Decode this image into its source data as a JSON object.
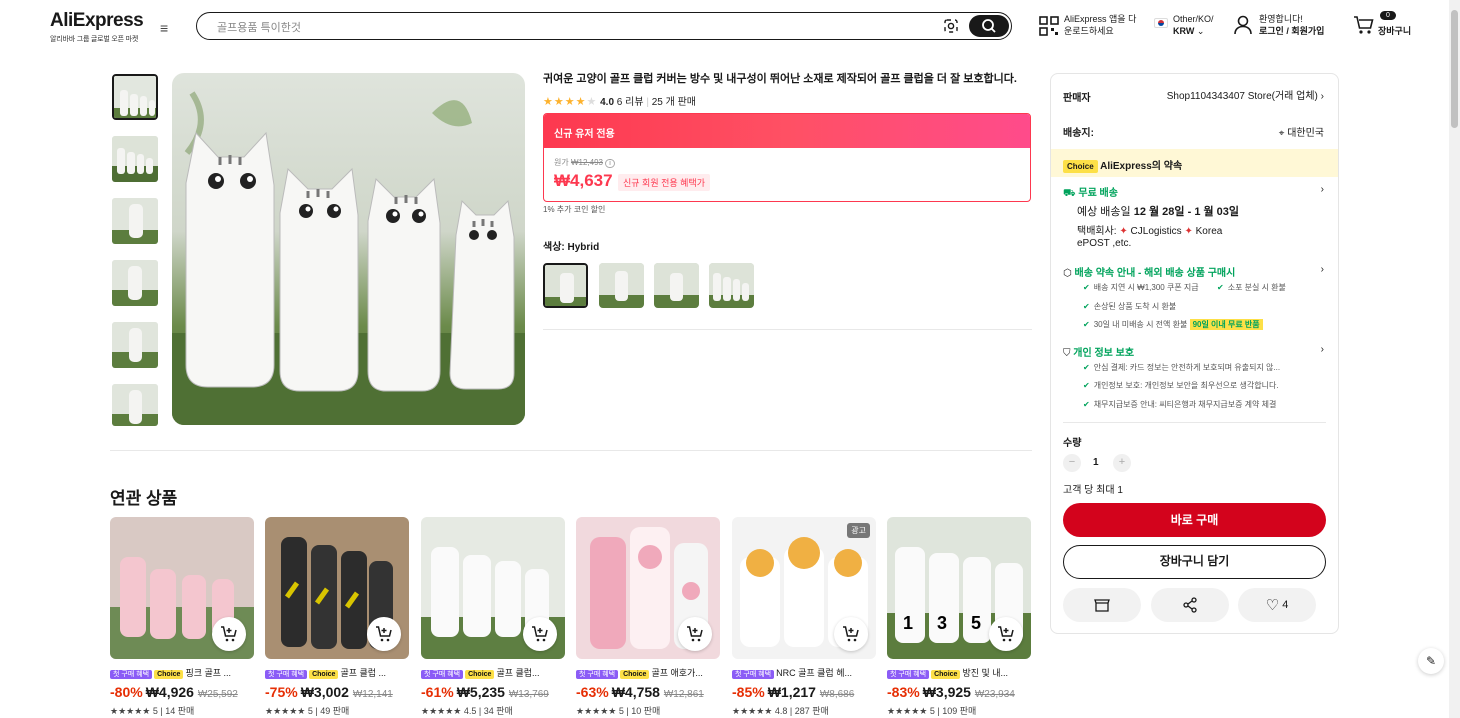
{
  "header": {
    "logo": "AliExpress",
    "logo_sub": "알리바바 그룹 글로벌 오픈 마켓",
    "search_placeholder": "골프용품 특이한것",
    "app_download_1": "AliExpress 앱을 다",
    "app_download_2": "운로드하세요",
    "locale_1": "Other/KO/",
    "locale_2": "KRW",
    "welcome": "환영합니다!",
    "login": "로그인 / 회원가입",
    "cart_count": "0",
    "cart_label": "장바구니"
  },
  "product": {
    "title": "귀여운 고양이 골프 클럽 커버는 방수 및 내구성이 뛰어난 소재로 제작되어 골프 클럽을 더 잘 보호합니다.",
    "rating": "4.0",
    "reviews": "6 리뷰",
    "sold": "25 개 판매",
    "promo_banner": "신규 유저 전용",
    "original_price_label": "원가",
    "original_price": "₩12,493",
    "price": "₩4,637",
    "price_tag": "신규 회원 전용 혜택가",
    "coin_discount": "1% 추가 코인 할인",
    "color_label": "색상:",
    "color_value": "Hybrid"
  },
  "related": {
    "title": "연관 상품",
    "first_tag": "첫 구매 혜택",
    "choice_tag": "Choice",
    "ad_tag": "광고",
    "items": [
      {
        "name": "핑크 골프 ...",
        "discount": "-80%",
        "price": "₩4,926",
        "was": "₩25,592",
        "rating": "5",
        "sold": "14 판매",
        "choice": true
      },
      {
        "name": "골프 클럽 ...",
        "discount": "-75%",
        "price": "₩3,002",
        "was": "₩12,141",
        "rating": "5",
        "sold": "49 판매",
        "choice": true
      },
      {
        "name": "골프 클럽...",
        "discount": "-61%",
        "price": "₩5,235",
        "was": "₩13,769",
        "rating": "4.5",
        "sold": "34 판매",
        "choice": true
      },
      {
        "name": "골프 애호가...",
        "discount": "-63%",
        "price": "₩4,758",
        "was": "₩12,861",
        "rating": "5",
        "sold": "10 판매",
        "choice": true
      },
      {
        "name": "NRC 골프 클럽 헤...",
        "discount": "-85%",
        "price": "₩1,217",
        "was": "₩8,686",
        "rating": "4.8",
        "sold": "287 판매",
        "choice": false
      },
      {
        "name": "방진 및 내...",
        "discount": "-83%",
        "price": "₩3,925",
        "was": "₩23,934",
        "rating": "5",
        "sold": "109 판매",
        "choice": true
      }
    ]
  },
  "panel": {
    "seller_label": "판매자",
    "seller": "Shop1104343407 Store(거래 업체)",
    "ship_to_label": "배송지:",
    "ship_to": "대한민국",
    "choice_chip": "Choice",
    "promise": "AliExpress의 약속",
    "free_ship": "무료 배송",
    "eta_label": "예상 배송일",
    "eta": "12 월 28일 - 1 월 03일",
    "carrier_label": "택배회사:",
    "carrier_1": "CJLogistics",
    "carrier_2": "Korea",
    "carrier_3": "ePOST ,etc.",
    "guarantee": "배송 약속 안내 - 해외 배송 상품 구매시",
    "g1": "배송 지연 시 ₩1,300 쿠폰 지급",
    "g2": "소포 분실 시 환불",
    "g3": "손상된 상품 도착 시 환불",
    "g4": "30일 내 미배송 시 전액 환불",
    "g4_badge": "90일 이내 무료 반품",
    "privacy": "개인 정보 보호",
    "p1": "안심 결제: 카드 정보는 안전하게 보호되며 유출되지 않...",
    "p2": "개인정보 보호: 개인정보 보안을 최우선으로 생각합니다.",
    "p3": "채무지급보증 안내: 씨티은행과 채무지급보증 계약 체결",
    "qty_label": "수량",
    "qty": "1",
    "max_label": "고객 당 최대 1",
    "buy_now": "바로 구매",
    "add_cart": "장바구니 담기",
    "wish_count": "4"
  },
  "colors": {
    "accent": "#d3031c",
    "promo": "#fd384f",
    "choice": "#fde047",
    "green": "#00a35c"
  }
}
